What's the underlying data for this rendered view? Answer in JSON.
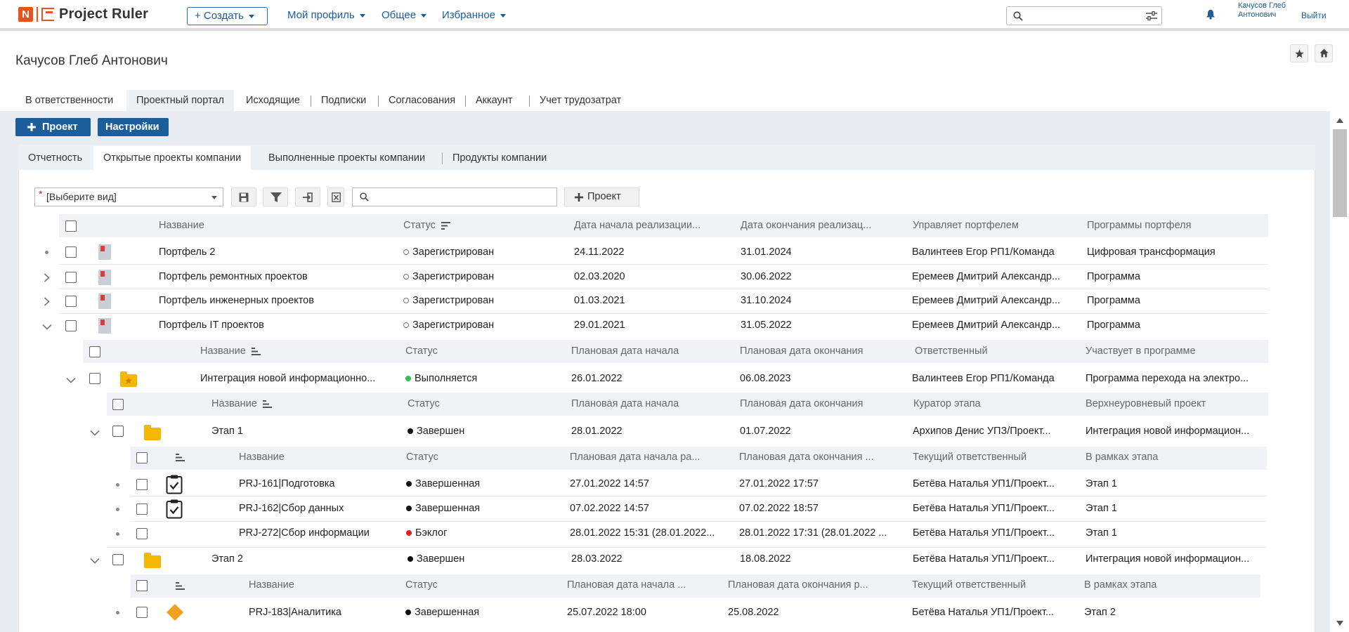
{
  "app": {
    "name": "Project Ruler",
    "create_label": "+ Создать",
    "nav": [
      "Мой профиль",
      "Общее",
      "Избранное"
    ],
    "user": "Качусов Глеб Антонович",
    "logout": "Выйти"
  },
  "page": {
    "title": "Качусов Глеб Антонович",
    "tabs": [
      "В ответственности",
      "Проектный портал",
      "Исходящие",
      "Подписки",
      "Согласования",
      "Аккаунт",
      "Учет трудозатрат"
    ],
    "active_tab": "Проектный портал",
    "project_button": "Проект",
    "settings_button": "Настройки"
  },
  "subtabs": {
    "items": [
      "Отчетность",
      "Открытые проекты компании",
      "Выполненные проекты компании",
      "Продукты компании"
    ],
    "active": "Открытые проекты компании"
  },
  "toolbar": {
    "view_select": "[Выберите вид]",
    "search_placeholder": "",
    "add_project": "Проект"
  },
  "portfolio_table": {
    "headers": [
      "Название",
      "Статус",
      "Дата начала реализации...",
      "Дата окончания реализац...",
      "Управляет портфелем",
      "Программы портфеля"
    ],
    "rows": [
      {
        "name": "Портфель 2",
        "status": "Зарегистрирован",
        "start": "24.11.2022",
        "end": "31.01.2024",
        "manager": "Валинтеев Егор РП1/Команда",
        "program": "Цифровая трансформация"
      },
      {
        "name": "Портфель ремонтных проектов",
        "status": "Зарегистрирован",
        "start": "02.03.2020",
        "end": "30.06.2022",
        "manager": "Еремеев Дмитрий Александр...",
        "program": "Программа"
      },
      {
        "name": "Портфель инженерных проектов",
        "status": "Зарегистрирован",
        "start": "01.03.2021",
        "end": "31.10.2024",
        "manager": "Еремеев Дмитрий Александр...",
        "program": "Программа"
      },
      {
        "name": "Портфель IT проектов",
        "status": "Зарегистрирован",
        "start": "29.01.2021",
        "end": "31.05.2022",
        "manager": "Еремеев Дмитрий Александр...",
        "program": "Программа"
      }
    ]
  },
  "project_table": {
    "headers": [
      "Название",
      "Статус",
      "Плановая дата начала",
      "Плановая дата окончания",
      "Ответственный",
      "Участвует в программе"
    ],
    "row": {
      "name": "Интеграция новой информационно...",
      "status": "Выполняется",
      "start": "26.01.2022",
      "end": "06.08.2023",
      "owner": "Валинтеев Егор РП1/Команда",
      "program": "Программа перехода на электро..."
    }
  },
  "stage_table": {
    "headers": [
      "Название",
      "Статус",
      "Плановая дата начала",
      "Плановая дата окончания",
      "Куратор этапа",
      "Верхнеуровневый проект"
    ],
    "stage1": {
      "name": "Этап 1",
      "status": "Завершен",
      "start": "28.01.2022",
      "end": "01.07.2022",
      "curator": "Архипов Денис УПЗ/Проект...",
      "project": "Интеграция новой информацион..."
    },
    "stage2": {
      "name": "Этап 2",
      "status": "Завершен",
      "start": "28.03.2022",
      "end": "18.08.2022",
      "curator": "Бетёва Наталья УП1/Проект...",
      "project": "Интеграция новой информацион..."
    }
  },
  "task_table1": {
    "headers": [
      "Название",
      "Статус",
      "Плановая дата начала ра...",
      "Плановая дата окончания ...",
      "Текущий ответственный",
      "В рамках этапа"
    ],
    "rows": [
      {
        "name": "PRJ-161|Подготовка",
        "status": "Завершенная",
        "start": "27.01.2022 14:57",
        "end": "27.01.2022 17:57",
        "owner": "Бетёва Наталья УП1/Проект...",
        "stage": "Этап 1"
      },
      {
        "name": "PRJ-162|Сбор данных",
        "status": "Завершенная",
        "start": "07.02.2022 14:57",
        "end": "07.02.2022 18:57",
        "owner": "Бетёва Наталья УП1/Проект...",
        "stage": "Этап 1"
      },
      {
        "name": "PRJ-272|Сбор информации",
        "status": "Бэклог",
        "start": "28.01.2022 15:31 (28.01.2022...",
        "end": "28.01.2022 17:31 (28.01.2022 ...",
        "owner": "Бетёва Наталья УП1/Проект...",
        "stage": "Этап 1"
      }
    ]
  },
  "task_table2": {
    "headers": [
      "Название",
      "Статус",
      "Плановая дата начала ...",
      "Плановая дата окончания р...",
      "Текущий ответственный",
      "В рамках этапа"
    ],
    "rows": [
      {
        "name": "PRJ-183|Аналитика",
        "status": "Завершенная",
        "start": "25.07.2022 18:00",
        "end": "25.08.2022",
        "owner": "Бетёва Наталья УП1/Проект...",
        "stage": "Этап 2"
      }
    ]
  },
  "colors": {
    "accent": "#1c5d9b",
    "brand": "#e8531c",
    "link": "#1a5c9e",
    "green": "#2ec44a",
    "red": "#e02020",
    "black": "#111111"
  }
}
